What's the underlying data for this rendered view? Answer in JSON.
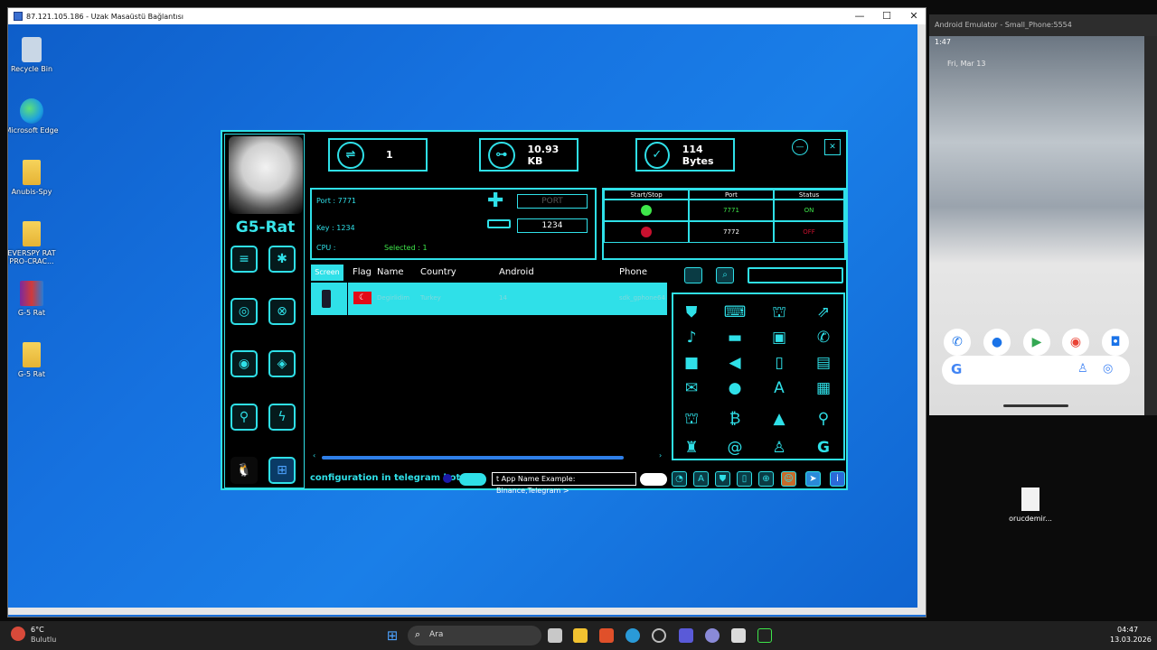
{
  "rdp": {
    "title": "87.121.105.186 - Uzak Masaüstü Bağlantısı",
    "min": "—",
    "max": "☐",
    "close": "✕"
  },
  "desktop_icons": [
    {
      "label": "Recycle Bin",
      "icon": "recycle-bin-icon"
    },
    {
      "label": "Microsoft Edge",
      "icon": "edge-icon"
    },
    {
      "label": "Anubis-Spy",
      "icon": "folder-icon"
    },
    {
      "label": "EVERSPY RAT PRO-CRAC...",
      "icon": "folder-icon"
    },
    {
      "label": "G-5 Rat",
      "icon": "winrar-icon"
    },
    {
      "label": "G-5 Rat",
      "icon": "folder-icon"
    }
  ],
  "app": {
    "name": "G5-Rat",
    "stats": {
      "connections": "1",
      "data": "10.93 KB",
      "bytes": "114 Bytes"
    },
    "min_btn": "—",
    "close_btn": "✕",
    "config": {
      "port_label": "Port : 7771",
      "key_label": "Key : 1234",
      "cpu_label": "CPU :",
      "selected_label": "Selected : 1",
      "port_placeholder": "PORT",
      "key_value": "1234"
    },
    "ports_table": {
      "headers": [
        "Start/Stop",
        "Port",
        "Status"
      ],
      "rows": [
        {
          "port": "7771",
          "status": "ON",
          "status_color": "#3ee64a"
        },
        {
          "port": "7772",
          "status": "OFF",
          "status_color": "#c8102e"
        }
      ]
    },
    "clients_table": {
      "headers": [
        "Screen",
        "Flag",
        "Name",
        "Country",
        "Android",
        "Phone"
      ],
      "row": {
        "name": "Degirlidim",
        "country": "Turkey",
        "android": "14",
        "phone": "sdk_gphone64"
      }
    },
    "footer": {
      "config_text": "configuration in telegram bot",
      "input_value": "t App Name Example: Binance,Telegram >"
    },
    "accent": "#2fe0e8"
  },
  "taskbar": {
    "weather_temp": "6°C",
    "weather_desc": "Bulutlu",
    "search_text": "Ara",
    "time": "04:47",
    "date": "13.03.2026"
  },
  "emulator": {
    "title": "Android Emulator - Small_Phone:5554",
    "time": "1:47",
    "date": "Fri, Mar 13"
  },
  "desktop_file": {
    "label": "orucdemir..."
  }
}
